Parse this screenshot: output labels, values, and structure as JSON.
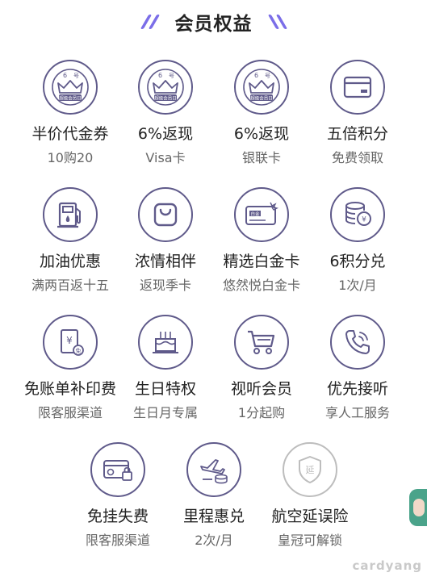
{
  "header": {
    "title": "会员权益"
  },
  "benefits": [
    {
      "label": "半价代金券",
      "sub": "10购20",
      "icon": "crown-badge-icon",
      "badge_num": "6",
      "badge_char": "号",
      "badge_text": "超级会员日"
    },
    {
      "label": "6%返现",
      "sub": "Visa卡",
      "icon": "crown-badge-icon",
      "badge_num": "6",
      "badge_char": "号",
      "badge_text": "超级会员日"
    },
    {
      "label": "6%返现",
      "sub": "银联卡",
      "icon": "crown-badge-icon",
      "badge_num": "6",
      "badge_char": "号",
      "badge_text": "超级会员日"
    },
    {
      "label": "五倍积分",
      "sub": "免费领取",
      "icon": "card-icon"
    },
    {
      "label": "加油优惠",
      "sub": "满两百返十五",
      "icon": "gas-pump-icon"
    },
    {
      "label": "浓情相伴",
      "sub": "返现季卡",
      "icon": "shopping-bag-icon"
    },
    {
      "label": "精选白金卡",
      "sub": "悠然悦白金卡",
      "icon": "platinum-card-icon",
      "card_text": "白金"
    },
    {
      "label": "6积分兑",
      "sub": "1次/月",
      "icon": "coins-icon"
    },
    {
      "label": "免账单补印费",
      "sub": "限客服渠道",
      "icon": "bill-icon"
    },
    {
      "label": "生日特权",
      "sub": "生日月专属",
      "icon": "cake-icon"
    },
    {
      "label": "视听会员",
      "sub": "1分起购",
      "icon": "cart-icon"
    },
    {
      "label": "优先接听",
      "sub": "享人工服务",
      "icon": "phone-icon"
    },
    {
      "label": "免挂失费",
      "sub": "限客服渠道",
      "icon": "card-lock-icon"
    },
    {
      "label": "里程惠兑",
      "sub": "2次/月",
      "icon": "plane-coins-icon"
    },
    {
      "label": "航空延误险",
      "sub": "皇冠可解锁",
      "icon": "shield-icon",
      "shield_char": "延"
    }
  ],
  "watermark": "cardyang",
  "colors": {
    "accent": "#7b6ee8",
    "icon_stroke": "#5f5a8a",
    "disabled": "#bdbdbd"
  }
}
